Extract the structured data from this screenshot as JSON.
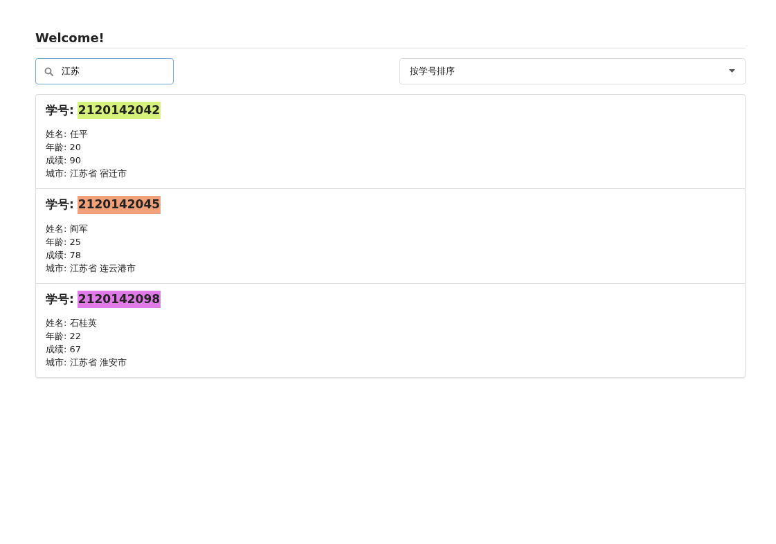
{
  "title": "Welcome!",
  "search": {
    "value": "江苏"
  },
  "sort": {
    "value": "按学号排序"
  },
  "students": [
    {
      "id_label": "学号:",
      "id": "2120142042",
      "color": "#d7f27a",
      "lines": [
        "姓名: 任平",
        "年龄: 20",
        "成绩: 90",
        "城市: 江苏省 宿迁市"
      ]
    },
    {
      "id_label": "学号:",
      "id": "2120142045",
      "color": "#f0a17a",
      "lines": [
        "姓名: 阎军",
        "年龄: 25",
        "成绩: 78",
        "城市: 江苏省 连云港市"
      ]
    },
    {
      "id_label": "学号:",
      "id": "2120142098",
      "color": "#e07ae9",
      "lines": [
        "姓名: 石桂英",
        "年龄: 22",
        "成绩: 67",
        "城市: 江苏省 淮安市"
      ]
    }
  ]
}
